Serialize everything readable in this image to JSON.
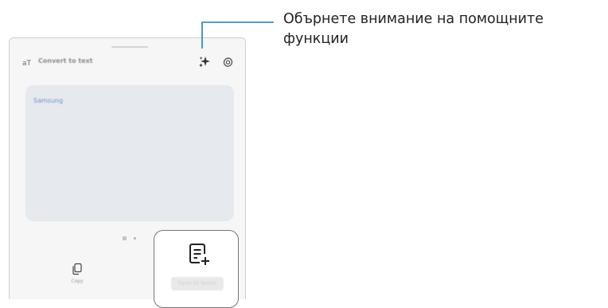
{
  "panel": {
    "title": "Convert to text",
    "card_text": "Samsung",
    "page_indicator": {
      "pages": 2,
      "current": 1
    }
  },
  "icons": {
    "mode": "text-convert-icon",
    "assist": "sparkle-icon",
    "settings": "gear-icon",
    "copy": "copy-icon",
    "save": "note-add-icon"
  },
  "toolbar": {
    "copy_label": "Copy",
    "save_label": "Save to Notes"
  },
  "callout": {
    "text": "Обърнете внимание на помощните функции"
  },
  "colors": {
    "callout_line": "#1a7fb5",
    "card_background": "#e6eaee",
    "card_text": "#6f8fcf",
    "highlight_border": "#777777"
  }
}
